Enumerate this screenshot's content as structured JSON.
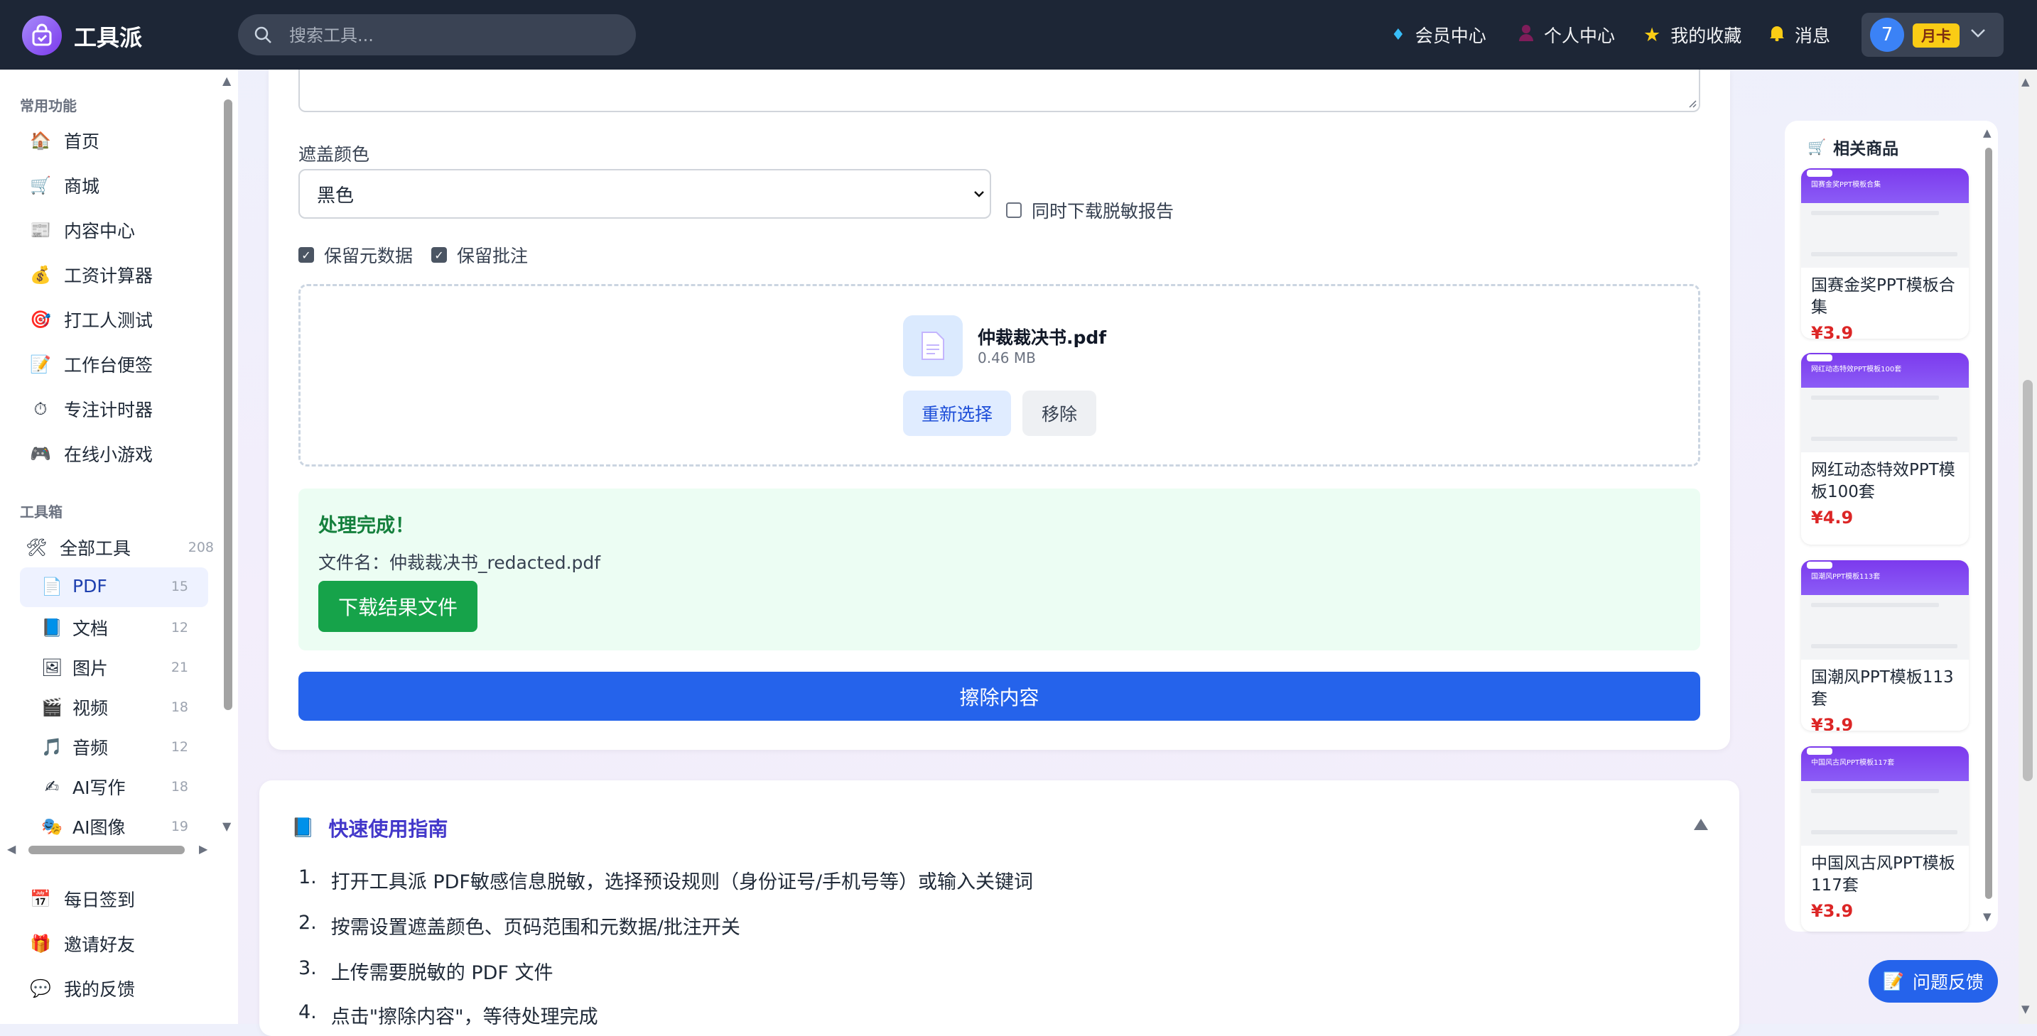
{
  "app": {
    "name": "工具派"
  },
  "topbar": {
    "search_placeholder": "搜索工具...",
    "links": [
      "会员中心",
      "个人中心",
      "我的收藏",
      "消息"
    ],
    "user": {
      "avatar": "7",
      "badge": "月卡"
    }
  },
  "sidebar": {
    "common_title": "常用功能",
    "common": [
      "首页",
      "商城",
      "内容中心",
      "工资计算器",
      "打工人测试",
      "工作台便签",
      "专注计时器",
      "在线小游戏"
    ],
    "toolbox_title": "工具箱",
    "all_tools": {
      "label": "全部工具",
      "count": "208"
    },
    "categories": [
      {
        "label": "PDF",
        "count": "15"
      },
      {
        "label": "文档",
        "count": "12"
      },
      {
        "label": "图片",
        "count": "21"
      },
      {
        "label": "视频",
        "count": "18"
      },
      {
        "label": "音频",
        "count": "12"
      },
      {
        "label": "AI写作",
        "count": "18"
      },
      {
        "label": "AI图像",
        "count": "19"
      }
    ],
    "bottom": [
      "每日签到",
      "邀请好友",
      "我的反馈"
    ]
  },
  "form": {
    "color_label": "遮盖颜色",
    "color_value": "黑色",
    "report_checkbox": "同时下载脱敏报告",
    "keep_metadata": "保留元数据",
    "keep_comments": "保留批注",
    "file": {
      "name": "仲裁裁决书.pdf",
      "size": "0.46 MB"
    },
    "reselect": "重新选择",
    "remove": "移除"
  },
  "result": {
    "title": "处理完成！",
    "filename": "文件名：仲裁裁决书_redacted.pdf",
    "download": "下载结果文件"
  },
  "erase_button": "擦除内容",
  "guide": {
    "title": "快速使用指南",
    "steps": [
      {
        "n": "1.",
        "text": "打开工具派 PDF敏感信息脱敏，选择预设规则（身份证号/手机号等）或输入关键词"
      },
      {
        "n": "2.",
        "text": "按需设置遮盖颜色、页码范围和元数据/批注开关"
      },
      {
        "n": "3.",
        "text": "上传需要脱敏的 PDF 文件"
      },
      {
        "n": "4.",
        "text": "点击\"擦除内容\"，等待处理完成"
      }
    ]
  },
  "related": {
    "title": "相关商品",
    "items": [
      {
        "name": "国赛金奖PPT模板合集",
        "price": "¥3.9",
        "thumb": "国赛金奖PPT模板合集"
      },
      {
        "name": "网红动态特效PPT模板100套",
        "price": "¥4.9",
        "thumb": "网红动态特效PPT模板100套"
      },
      {
        "name": "国潮风PPT模板113套",
        "price": "¥3.9",
        "thumb": "国潮风PPT模板113套"
      },
      {
        "name": "中国风古风PPT模板117套",
        "price": "¥3.9",
        "thumb": "中国风古风PPT模板117套"
      }
    ]
  },
  "feedback_button": "问题反馈",
  "colors": {
    "topbar": "#1d2636",
    "primary": "#2563eb",
    "success": "#16a34a",
    "price": "#dc2626",
    "accent": "#7c3aed"
  }
}
